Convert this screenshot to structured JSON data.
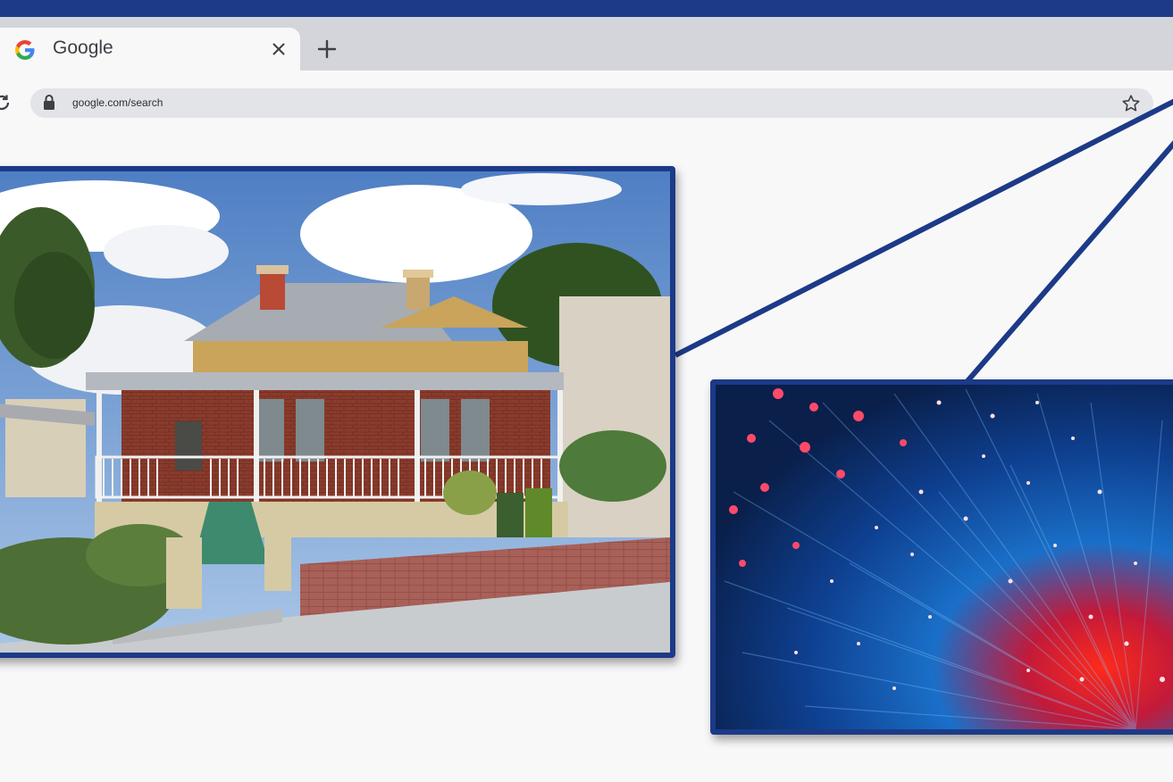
{
  "browser": {
    "tab": {
      "title": "Google",
      "favicon": "google-g-logo-icon",
      "close_icon": "close-icon"
    },
    "new_tab_icon": "plus-icon",
    "address_bar": {
      "url": "google.com/search",
      "lock_icon": "lock-icon",
      "bookmark_icon": "star-icon",
      "reload_icon": "reload-icon"
    }
  },
  "images": [
    {
      "name": "house-photo",
      "subject": "brick federation-style house with verandah"
    },
    {
      "name": "fiber-optic-photo",
      "subject": "blue and red fibre optic strands"
    }
  ],
  "colors": {
    "accent": "#1c3a87",
    "tabstrip": "#d3d5da",
    "page_bg": "#f8f8f9",
    "omnibox": "#e2e4e8"
  }
}
